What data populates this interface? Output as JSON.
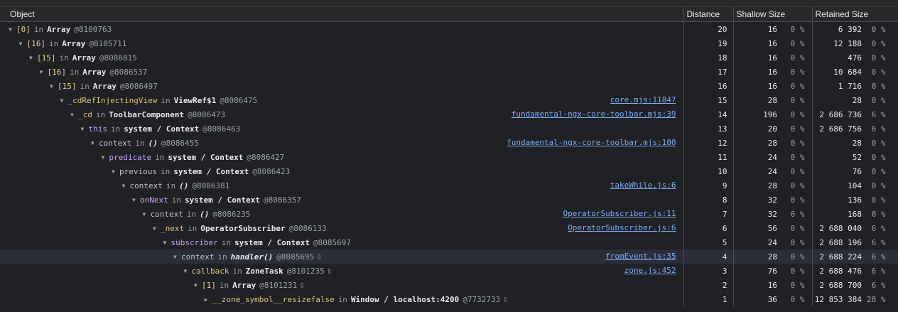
{
  "top_fragment": "",
  "columns": {
    "object": "Object",
    "distance": "Distance",
    "shallow": "Shallow Size",
    "retained": "Retained Size"
  },
  "rows": [
    {
      "key": "[0]",
      "kind": "idx",
      "in": "in",
      "type": "Array",
      "oid": "@8100763",
      "dist": "20",
      "shallow": "16",
      "shallow_pct": "0 %",
      "retained": "6 392",
      "retained_pct": "0 %",
      "open": true
    },
    {
      "key": "[16]",
      "kind": "idx",
      "in": "in",
      "type": "Array",
      "oid": "@8105711",
      "dist": "19",
      "shallow": "16",
      "shallow_pct": "0 %",
      "retained": "12 188",
      "retained_pct": "0 %",
      "open": true
    },
    {
      "key": "[15]",
      "kind": "idx",
      "in": "in",
      "type": "Array",
      "oid": "@8086815",
      "dist": "18",
      "shallow": "16",
      "shallow_pct": "0 %",
      "retained": "476",
      "retained_pct": "0 %",
      "open": true
    },
    {
      "key": "[16]",
      "kind": "idx",
      "in": "in",
      "type": "Array",
      "oid": "@8086537",
      "dist": "17",
      "shallow": "16",
      "shallow_pct": "0 %",
      "retained": "10 684",
      "retained_pct": "0 %",
      "open": true
    },
    {
      "key": "[15]",
      "kind": "idx",
      "in": "in",
      "type": "Array",
      "oid": "@8086497",
      "dist": "16",
      "shallow": "16",
      "shallow_pct": "0 %",
      "retained": "1 716",
      "retained_pct": "0 %",
      "open": true
    },
    {
      "key": "_cdRefInjectingView",
      "kind": "prop",
      "in": "in",
      "type": "ViewRef$1",
      "oid": "@8086475",
      "link": "core.mjs:11847",
      "dist": "15",
      "shallow": "28",
      "shallow_pct": "0 %",
      "retained": "28",
      "retained_pct": "0 %",
      "open": true
    },
    {
      "key": "_cd",
      "kind": "prop",
      "in": "in",
      "type": "ToolbarComponent",
      "oid": "@8086473",
      "link": "fundamental-ngx-core-toolbar.mjs:39",
      "dist": "14",
      "shallow": "196",
      "shallow_pct": "0 %",
      "retained": "2 686 736",
      "retained_pct": "6 %",
      "open": true
    },
    {
      "key": "this",
      "kind": "fn",
      "in": "in",
      "type": "system / Context",
      "oid": "@8086463",
      "dist": "13",
      "shallow": "20",
      "shallow_pct": "0 %",
      "retained": "2 686 756",
      "retained_pct": "6 %",
      "open": true
    },
    {
      "key": "context",
      "kind": "plain",
      "in": "in",
      "type": "()",
      "italic": true,
      "oid": "@8086455",
      "link": "fundamental-ngx-core-toolbar.mjs:100",
      "dist": "12",
      "shallow": "28",
      "shallow_pct": "0 %",
      "retained": "28",
      "retained_pct": "0 %",
      "open": true
    },
    {
      "key": "predicate",
      "kind": "fn",
      "in": "in",
      "type": "system / Context",
      "oid": "@8086427",
      "dist": "11",
      "shallow": "24",
      "shallow_pct": "0 %",
      "retained": "52",
      "retained_pct": "0 %",
      "open": true
    },
    {
      "key": "previous",
      "kind": "plain",
      "in": "in",
      "type": "system / Context",
      "oid": "@8086423",
      "dist": "10",
      "shallow": "24",
      "shallow_pct": "0 %",
      "retained": "76",
      "retained_pct": "0 %",
      "open": true
    },
    {
      "key": "context",
      "kind": "plain",
      "in": "in",
      "type": "()",
      "italic": true,
      "oid": "@8086381",
      "link": "takeWhile.js:6",
      "dist": "9",
      "shallow": "28",
      "shallow_pct": "0 %",
      "retained": "104",
      "retained_pct": "0 %",
      "open": true
    },
    {
      "key": "onNext",
      "kind": "fn",
      "in": "in",
      "type": "system / Context",
      "oid": "@8086357",
      "dist": "8",
      "shallow": "32",
      "shallow_pct": "0 %",
      "retained": "136",
      "retained_pct": "0 %",
      "open": true
    },
    {
      "key": "context",
      "kind": "plain",
      "in": "in",
      "type": "()",
      "italic": true,
      "oid": "@8086235",
      "link": "OperatorSubscriber.js:11",
      "dist": "7",
      "shallow": "32",
      "shallow_pct": "0 %",
      "retained": "168",
      "retained_pct": "0 %",
      "open": true
    },
    {
      "key": "_next",
      "kind": "prop",
      "in": "in",
      "type": "OperatorSubscriber",
      "oid": "@8086133",
      "link": "OperatorSubscriber.js:6",
      "dist": "6",
      "shallow": "56",
      "shallow_pct": "0 %",
      "retained": "2 688 040",
      "retained_pct": "6 %",
      "open": true
    },
    {
      "key": "subscriber",
      "kind": "fn",
      "in": "in",
      "type": "system / Context",
      "oid": "@8085697",
      "dist": "5",
      "shallow": "24",
      "shallow_pct": "0 %",
      "retained": "2 688 196",
      "retained_pct": "6 %",
      "open": true
    },
    {
      "key": "context",
      "kind": "plain",
      "in": "in",
      "type": "handler()",
      "italic": true,
      "oid": "@8085695",
      "mark": "▯",
      "link": "fromEvent.js:35",
      "dist": "4",
      "shallow": "28",
      "shallow_pct": "0 %",
      "retained": "2 688 224",
      "retained_pct": "6 %",
      "open": true,
      "selected": true
    },
    {
      "key": "callback",
      "kind": "prop",
      "in": "in",
      "type": "ZoneTask",
      "oid": "@8101235",
      "mark": "▯",
      "link": "zone.js:452",
      "dist": "3",
      "shallow": "76",
      "shallow_pct": "0 %",
      "retained": "2 688 476",
      "retained_pct": "6 %",
      "open": true
    },
    {
      "key": "[1]",
      "kind": "idx",
      "in": "in",
      "type": "Array",
      "oid": "@8101231",
      "mark": "▯",
      "dist": "2",
      "shallow": "16",
      "shallow_pct": "0 %",
      "retained": "2 688 700",
      "retained_pct": "6 %",
      "open": true
    },
    {
      "key": "__zone_symbol__resizefalse",
      "kind": "prop",
      "in": "in",
      "type": "Window / localhost:4200",
      "oid": "@7732733",
      "mark": "▯",
      "dist": "1",
      "shallow": "36",
      "shallow_pct": "0 %",
      "retained": "12 853 384",
      "retained_pct": "28 %",
      "open": false
    }
  ]
}
